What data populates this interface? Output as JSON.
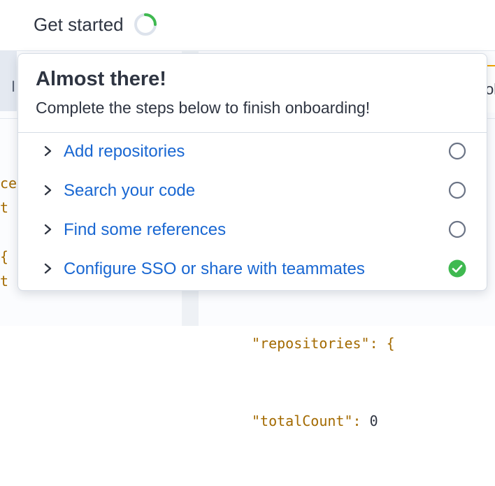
{
  "topbar": {
    "get_started_label": "Get started",
    "progress_fraction": 0.25,
    "progress_color": "#3fb950"
  },
  "background": {
    "left_panel_fragment": "I",
    "right_tab_fragment": "ol",
    "left_code_lines": [
      "ce",
      "t",
      "",
      "{",
      "t"
    ],
    "right_code_lines": [
      {
        "text": "\"repositories\": {",
        "value": ""
      },
      {
        "text": "\"totalCount\": ",
        "value": "0"
      }
    ]
  },
  "popover": {
    "title": "Almost there!",
    "subtitle": "Complete the steps below to finish onboarding!",
    "steps": [
      {
        "label": "Add repositories",
        "icon": "chevron-right-icon",
        "status": "incomplete",
        "status_icon": "circle-outline-icon"
      },
      {
        "label": "Search your code",
        "icon": "chevron-right-icon",
        "status": "incomplete",
        "status_icon": "circle-outline-icon"
      },
      {
        "label": "Find some references",
        "icon": "chevron-right-icon",
        "status": "incomplete",
        "status_icon": "circle-outline-icon"
      },
      {
        "label": "Configure SSO or share with teammates",
        "icon": "chevron-right-icon",
        "status": "complete",
        "status_icon": "check-circle-icon"
      }
    ]
  },
  "colors": {
    "link": "#1967d2",
    "complete": "#3fb950",
    "incomplete": "#6a7385",
    "accent_tab": "#f0a400"
  }
}
